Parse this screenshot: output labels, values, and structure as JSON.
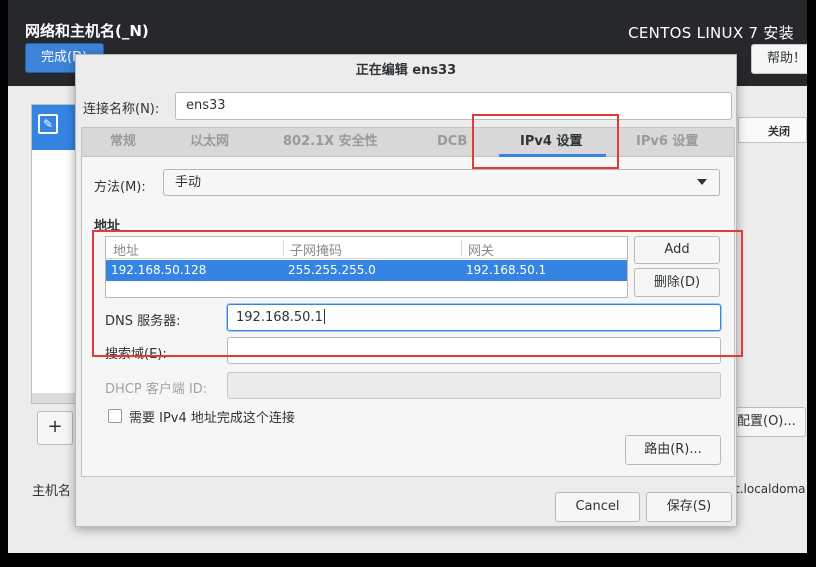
{
  "installer": {
    "spoke_title": "网络和主机名(_N)",
    "done_label": "完成(D)",
    "product_title": "CENTOS LINUX 7 安装",
    "help_label": "帮助！",
    "hostname_label": "主机名",
    "add_label": "+",
    "toggle_label": "关闭",
    "configure_label": "配置(O)...",
    "hostname_value_partial": "t.localdoma"
  },
  "dialog": {
    "title": "正在编辑 ens33",
    "connection_name_label": "连接名称(N):",
    "connection_name_value": "ens33",
    "tabs": [
      {
        "label": "常规",
        "active": false
      },
      {
        "label": "以太网",
        "active": false
      },
      {
        "label": "802.1X 安全性",
        "active": false
      },
      {
        "label": "DCB",
        "active": false
      },
      {
        "label": "IPv4 设置",
        "active": true
      },
      {
        "label": "IPv6 设置",
        "active": false
      }
    ],
    "ipv4": {
      "method_label": "方法(M):",
      "method_value": "手动",
      "address_heading": "地址",
      "address_table": {
        "columns": [
          "地址",
          "子网掩码",
          "网关"
        ],
        "rows": [
          [
            "192.168.50.128",
            "255.255.255.0",
            "192.168.50.1"
          ]
        ]
      },
      "add_label": "Add",
      "delete_label": "删除(D)",
      "dns_label": "DNS 服务器:",
      "dns_value": "192.168.50.1",
      "search_domains_label": "搜索域(E):",
      "search_domains_value": "",
      "dhcp_client_id_label": "DHCP 客户端 ID:",
      "require_ipv4_label": "需要 IPv4 地址完成这个连接",
      "require_ipv4_checked": false,
      "routes_label": "路由(R)..."
    },
    "cancel_label": "Cancel",
    "save_label": "保存(S)"
  },
  "colors": {
    "selection": "#3584e4",
    "annotation": "#e23a3a",
    "topbar": "#27282b",
    "done_button": "#3d84d8"
  }
}
